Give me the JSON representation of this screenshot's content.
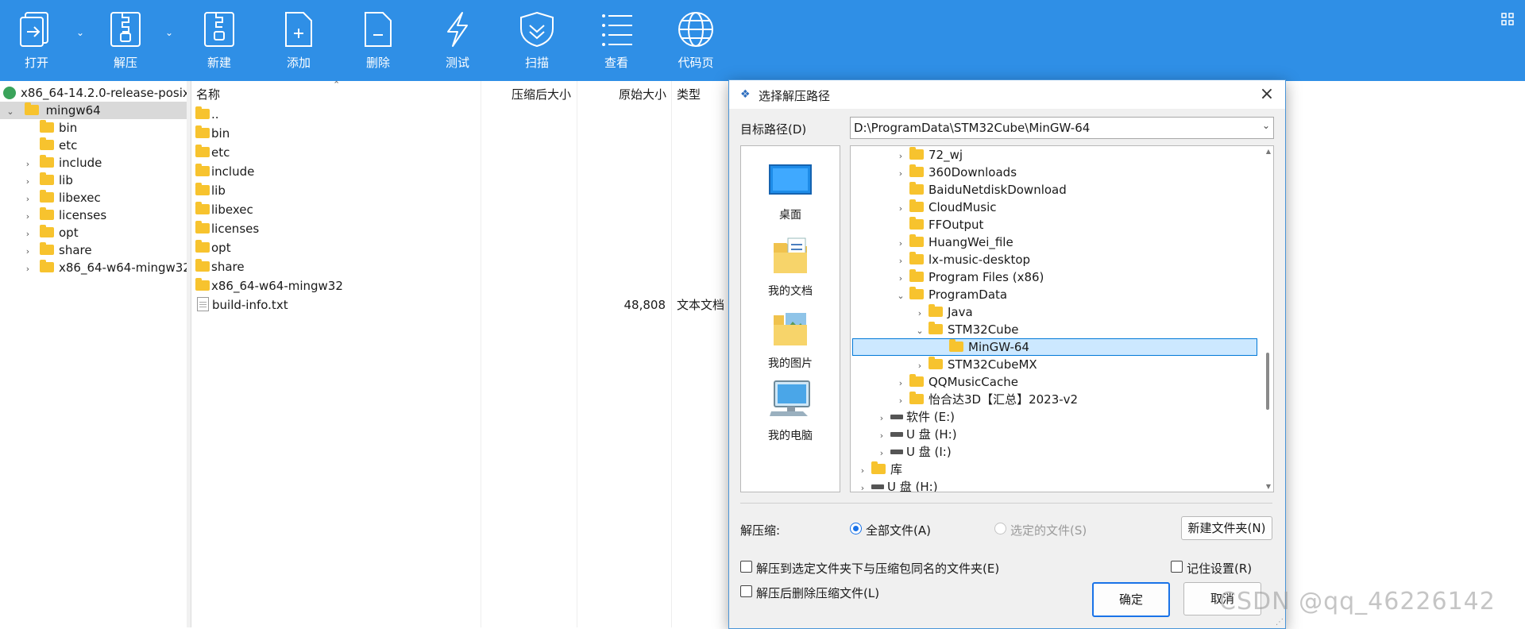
{
  "toolbar": {
    "buttons": [
      {
        "label": "打开",
        "icon": "open-icon"
      },
      {
        "label": "解压",
        "icon": "extract-icon"
      },
      {
        "label": "新建",
        "icon": "new-archive-icon"
      },
      {
        "label": "添加",
        "icon": "add-icon"
      },
      {
        "label": "删除",
        "icon": "delete-icon"
      },
      {
        "label": "测试",
        "icon": "test-icon"
      },
      {
        "label": "扫描",
        "icon": "scan-shield-icon"
      },
      {
        "label": "查看",
        "icon": "view-list-icon"
      },
      {
        "label": "代码页",
        "icon": "code-page-globe-icon"
      }
    ],
    "accent_color": "#2f8fe6"
  },
  "left_tree": {
    "archive": "x86_64-14.2.0-release-posix",
    "root_folder": "mingw64",
    "children": [
      "bin",
      "etc",
      "include",
      "lib",
      "libexec",
      "licenses",
      "opt",
      "share",
      "x86_64-w64-mingw32"
    ]
  },
  "file_list": {
    "columns": {
      "name": "名称",
      "packed": "压缩后大小",
      "size": "原始大小",
      "type": "类型"
    },
    "rows": [
      {
        "name": "..",
        "size": "",
        "type": ""
      },
      {
        "name": "bin",
        "size": "",
        "type": ""
      },
      {
        "name": "etc",
        "size": "",
        "type": ""
      },
      {
        "name": "include",
        "size": "",
        "type": ""
      },
      {
        "name": "lib",
        "size": "",
        "type": ""
      },
      {
        "name": "libexec",
        "size": "",
        "type": ""
      },
      {
        "name": "licenses",
        "size": "",
        "type": ""
      },
      {
        "name": "opt",
        "size": "",
        "type": ""
      },
      {
        "name": "share",
        "size": "",
        "type": ""
      },
      {
        "name": "x86_64-w64-mingw32",
        "size": "",
        "type": ""
      },
      {
        "name": "build-info.txt",
        "size": "48,808",
        "type": "文本文档"
      }
    ]
  },
  "dialog": {
    "title": "选择解压路径",
    "target_label": "目标路径(D)",
    "target_path": "D:\\ProgramData\\STM32Cube\\MinGW-64",
    "quick_access": [
      "桌面",
      "我的文档",
      "我的图片",
      "我的电脑"
    ],
    "folder_tree": [
      {
        "label": "72_wj"
      },
      {
        "label": "360Downloads"
      },
      {
        "label": "BaiduNetdiskDownload"
      },
      {
        "label": "CloudMusic"
      },
      {
        "label": "FFOutput"
      },
      {
        "label": "HuangWei_file"
      },
      {
        "label": "lx-music-desktop"
      },
      {
        "label": "Program Files (x86)"
      },
      {
        "label": "ProgramData"
      },
      {
        "label": "Java"
      },
      {
        "label": "STM32Cube"
      },
      {
        "label": "MinGW-64"
      },
      {
        "label": "STM32CubeMX"
      },
      {
        "label": "QQMusicCache"
      },
      {
        "label": "怡合达3D【汇总】2023-v2"
      },
      {
        "label": "软件 (E:)"
      },
      {
        "label": "U 盘 (H:)"
      },
      {
        "label": "U 盘 (I:)"
      },
      {
        "label": "库"
      },
      {
        "label": "U 盘 (H:)"
      }
    ],
    "extract_label": "解压缩:",
    "radio_all": "全部文件(A)",
    "radio_selected": "选定的文件(S)",
    "new_folder_button": "新建文件夹(N)",
    "check_subfolder": "解压到选定文件夹下与压缩包同名的文件夹(E)",
    "check_remember": "记住设置(R)",
    "check_delete": "解压后删除压缩文件(L)",
    "ok_button": "确定",
    "cancel_button": "取消",
    "close_icon": "close-icon"
  },
  "watermark": "CSDN @qq_46226142"
}
